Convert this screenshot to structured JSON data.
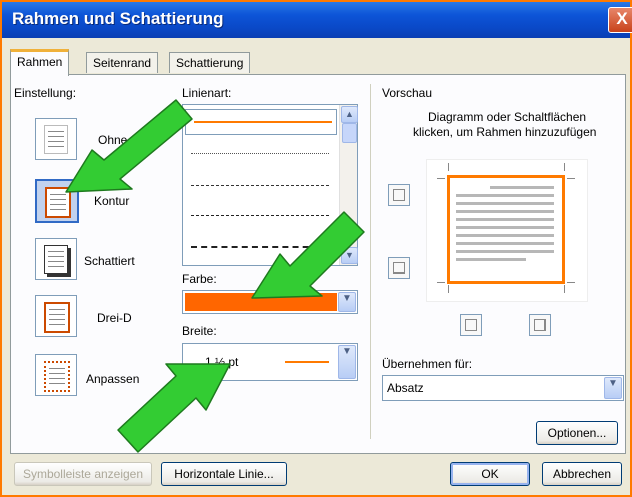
{
  "window": {
    "title": "Rahmen und Schattierung",
    "close": "X"
  },
  "tabs": [
    {
      "label": "Rahmen",
      "active": true
    },
    {
      "label": "Seitenrand",
      "active": false
    },
    {
      "label": "Schattierung",
      "active": false
    }
  ],
  "settings": {
    "heading": "Einstellung:",
    "items": [
      {
        "label": "Ohne"
      },
      {
        "label": "Kontur",
        "selected": true
      },
      {
        "label": "Schattiert"
      },
      {
        "label": "Drei-D"
      },
      {
        "label": "Anpassen"
      }
    ]
  },
  "line_style": {
    "heading": "Linienart:",
    "items": [
      "solid",
      "dotted",
      "dash-fine",
      "dash",
      "dash-dot"
    ]
  },
  "color": {
    "label": "Farbe:",
    "value": "#ff6600"
  },
  "width": {
    "label": "Breite:",
    "value": "1 ½ pt"
  },
  "preview": {
    "heading": "Vorschau",
    "hint_line1": "Diagramm oder Schaltflächen",
    "hint_line2": "klicken, um Rahmen hinzuzufügen"
  },
  "apply": {
    "label": "Übernehmen für:",
    "value": "Absatz"
  },
  "buttons": {
    "options": "Optionen...",
    "toolbar": "Symbolleiste anzeigen",
    "horizontal_line": "Horizontale Linie...",
    "ok": "OK",
    "cancel": "Abbrechen"
  },
  "colors": {
    "accent": "#ff7a00",
    "arrow": "#33cc33"
  }
}
